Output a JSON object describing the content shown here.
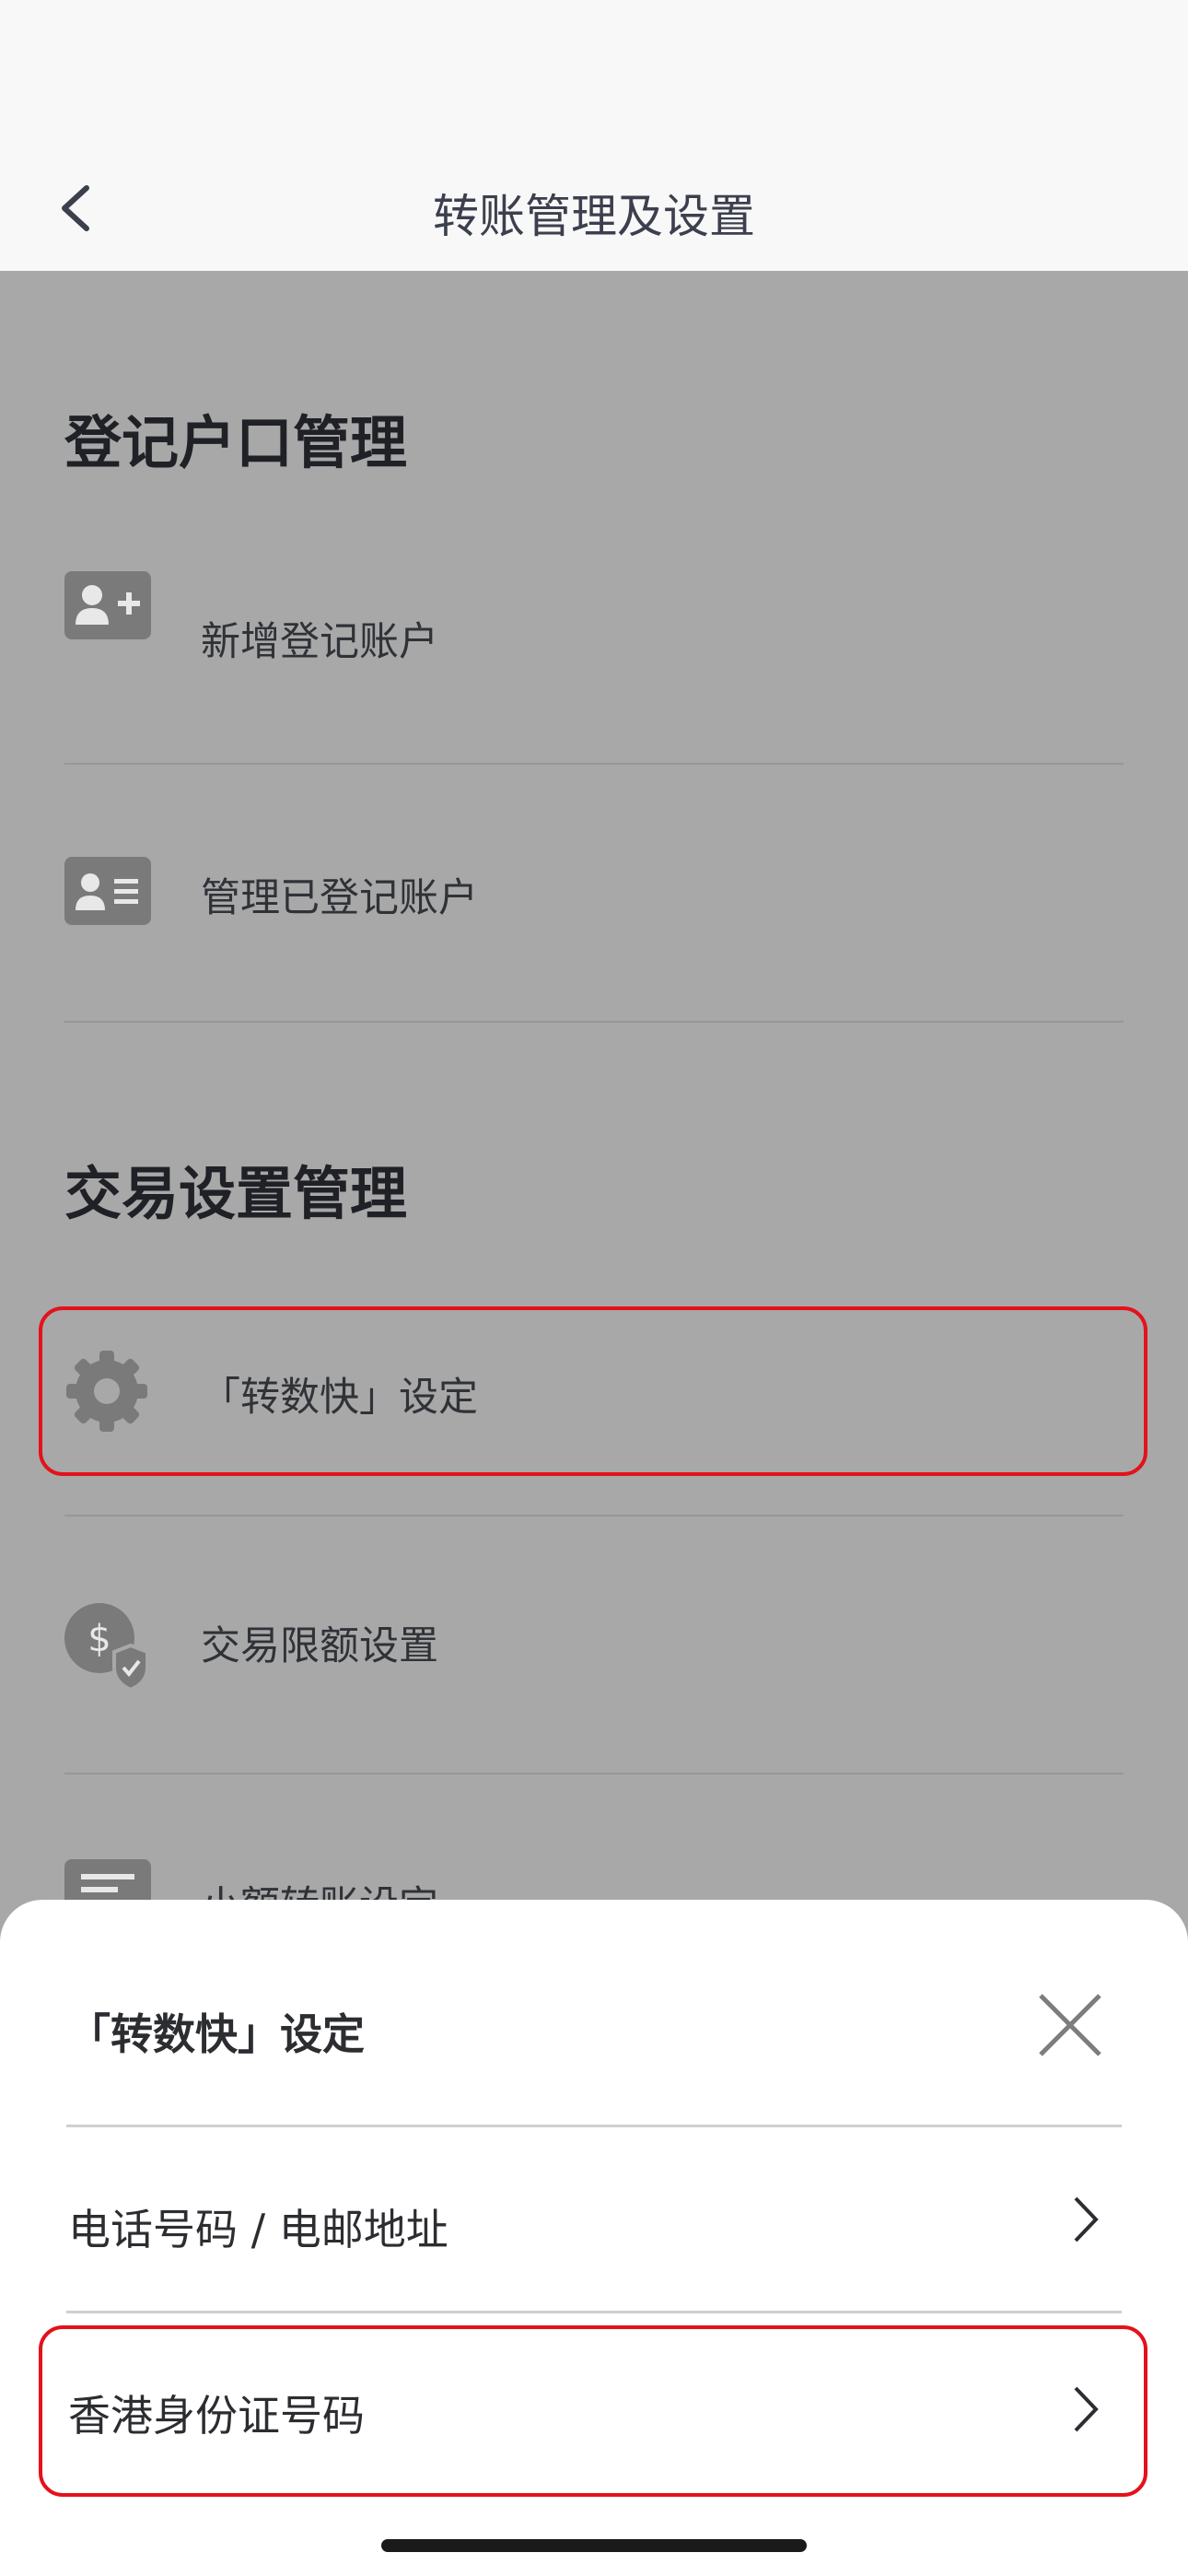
{
  "header": {
    "title": "转账管理及设置"
  },
  "sections": [
    {
      "title": "登记户口管理",
      "items": [
        {
          "label": "新增登记账户"
        },
        {
          "label": "管理已登记账户"
        }
      ]
    },
    {
      "title": "交易设置管理",
      "items": [
        {
          "label": "「转数快」设定"
        },
        {
          "label": "交易限额设置"
        },
        {
          "label": "小额转账设定"
        }
      ]
    }
  ],
  "sheet": {
    "title": "「转数快」设定",
    "options": [
      {
        "label": "电话号码 / 电邮地址"
      },
      {
        "label": "香港身份证号码"
      }
    ]
  },
  "colors": {
    "highlight": "#e3121b",
    "overlay": "#a8a8a8"
  }
}
